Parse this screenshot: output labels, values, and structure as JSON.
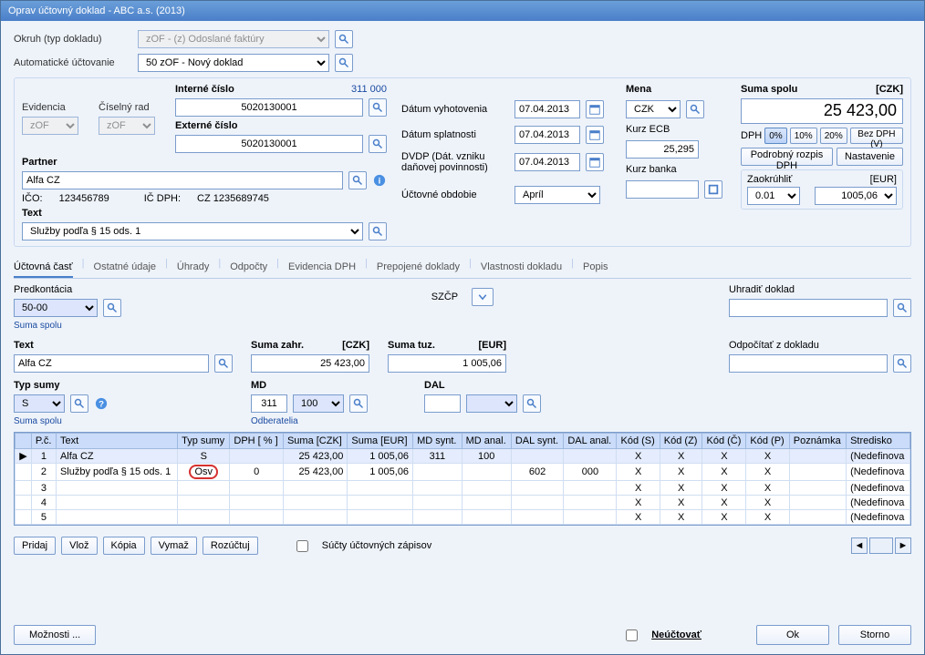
{
  "window": {
    "title": "Oprav účtovný doklad - ABC a.s. (2013)"
  },
  "header": {
    "okruh_label": "Okruh (typ dokladu)",
    "okruh_value": "zOF - (z) Odoslané faktúry",
    "auto_label": "Automatické účtovanie",
    "auto_value": "50 zOF - Nový doklad"
  },
  "ids": {
    "evidencia_label": "Evidencia",
    "evidencia_value": "zOF",
    "ciselnyrad_label": "Číselný rad",
    "ciselnyrad_value": "zOF",
    "interne_label": "Interné číslo",
    "interne_help": "311 000",
    "interne_value": "5020130001",
    "externe_label": "Externé číslo",
    "externe_value": "5020130001"
  },
  "partner": {
    "label": "Partner",
    "value": "Alfa CZ",
    "ico_label": "IČO:",
    "ico": "123456789",
    "icdph_label": "IČ DPH:",
    "icdph": "CZ 1235689745"
  },
  "text": {
    "label": "Text",
    "value": "Služby podľa § 15 ods. 1"
  },
  "dates": {
    "vyhotovenia_label": "Dátum vyhotovenia",
    "vyhotovenia": "07.04.2013",
    "splatnosti_label": "Dátum splatnosti",
    "splatnosti": "07.04.2013",
    "dvdp_label": "DVDP (Dát. vzniku daňovej povinnosti)",
    "dvdp": "07.04.2013",
    "obdobie_label": "Účtovné obdobie",
    "obdobie": "Apríl"
  },
  "currency": {
    "mena_label": "Mena",
    "mena_value": "CZK",
    "kurz_ecb_label": "Kurz ECB",
    "kurz_ecb": "25,295",
    "kurz_banka_label": "Kurz banka",
    "kurz_banka": ""
  },
  "sum": {
    "label": "Suma spolu",
    "ccy": "[CZK]",
    "value": "25 423,00",
    "dph_label": "DPH",
    "btn0": "0%",
    "btn10": "10%",
    "btn20": "20%",
    "btn_bezdph": "Bez DPH (V)",
    "btn_rozpis": "Podrobný rozpis DPH",
    "btn_nastavenie": "Nastavenie",
    "round_label": "Zaokrúhliť",
    "round_ccy": "[EUR]",
    "round_step": "0.01",
    "round_value": "1005,06"
  },
  "tabs": [
    "Účtovná časť",
    "Ostatné údaje",
    "Úhrady",
    "Odpočty",
    "Evidencia DPH",
    "Prepojené doklady",
    "Vlastnosti dokladu",
    "Popis"
  ],
  "mid": {
    "predk_label": "Predkontácia",
    "predk_value": "50-00",
    "predk_help": "Suma spolu",
    "szcp_label": "SZČP",
    "uhradit_label": "Uhradiť doklad",
    "uhradit_value": "",
    "text_label": "Text",
    "text_value": "Alfa CZ",
    "sumazahr_label": "Suma zahr.",
    "sumazahr_ccy": "[CZK]",
    "sumazahr_value": "25 423,00",
    "sumatuz_label": "Suma tuz.",
    "sumatuz_ccy": "[EUR]",
    "sumatuz_value": "1 005,06",
    "odpocitat_label": "Odpočítať z dokladu",
    "odpocitat_value": "",
    "typsumy_label": "Typ sumy",
    "typsumy_value": "S",
    "typsumy_help": "Suma spolu",
    "md_label": "MD",
    "md_a": "311",
    "md_b": "100",
    "md_help": "Odberatelia",
    "dal_label": "DAL",
    "dal_value": ""
  },
  "grid": {
    "columns": [
      "",
      "P.č.",
      "Text",
      "Typ sumy",
      "DPH [ % ]",
      "Suma [CZK]",
      "Suma [EUR]",
      "MD synt.",
      "MD anal.",
      "DAL synt.",
      "DAL anal.",
      "Kód (S)",
      "Kód (Z)",
      "Kód (Č)",
      "Kód (P)",
      "Poznámka",
      "Stredisko"
    ],
    "rows": [
      {
        "mark": "▶",
        "pc": "1",
        "text": "Alfa CZ",
        "typ": "S",
        "dph": "",
        "czk": "25 423,00",
        "eur": "1 005,06",
        "mds": "311",
        "mda": "100",
        "dals": "",
        "dala": "",
        "ks": "X",
        "kz": "X",
        "kc": "X",
        "kp": "X",
        "pozn": "",
        "str": "(Nedefinova",
        "ring": false
      },
      {
        "mark": "",
        "pc": "2",
        "text": "Služby podľa § 15 ods. 1",
        "typ": "Osv",
        "dph": "0",
        "czk": "25 423,00",
        "eur": "1 005,06",
        "mds": "",
        "mda": "",
        "dals": "602",
        "dala": "000",
        "ks": "X",
        "kz": "X",
        "kc": "X",
        "kp": "X",
        "pozn": "",
        "str": "(Nedefinova",
        "ring": true
      },
      {
        "mark": "",
        "pc": "3",
        "text": "",
        "typ": "",
        "dph": "",
        "czk": "",
        "eur": "",
        "mds": "",
        "mda": "",
        "dals": "",
        "dala": "",
        "ks": "X",
        "kz": "X",
        "kc": "X",
        "kp": "X",
        "pozn": "",
        "str": "(Nedefinova",
        "ring": false
      },
      {
        "mark": "",
        "pc": "4",
        "text": "",
        "typ": "",
        "dph": "",
        "czk": "",
        "eur": "",
        "mds": "",
        "mda": "",
        "dals": "",
        "dala": "",
        "ks": "X",
        "kz": "X",
        "kc": "X",
        "kp": "X",
        "pozn": "",
        "str": "(Nedefinova",
        "ring": false
      },
      {
        "mark": "",
        "pc": "5",
        "text": "",
        "typ": "",
        "dph": "",
        "czk": "",
        "eur": "",
        "mds": "",
        "mda": "",
        "dals": "",
        "dala": "",
        "ks": "X",
        "kz": "X",
        "kc": "X",
        "kp": "X",
        "pozn": "",
        "str": "(Nedefinova",
        "ring": false
      }
    ]
  },
  "gridbtns": {
    "pridaj": "Pridaj",
    "vloz": "Vlož",
    "kopia": "Kópia",
    "vymaz": "Vymaž",
    "rozuctuj": "Rozúčtuj",
    "sucty": "Súčty účtovných zápisov"
  },
  "footer": {
    "moznosti": "Možnosti ...",
    "neuctovat": "Neúčtovať",
    "ok": "Ok",
    "storno": "Storno"
  }
}
